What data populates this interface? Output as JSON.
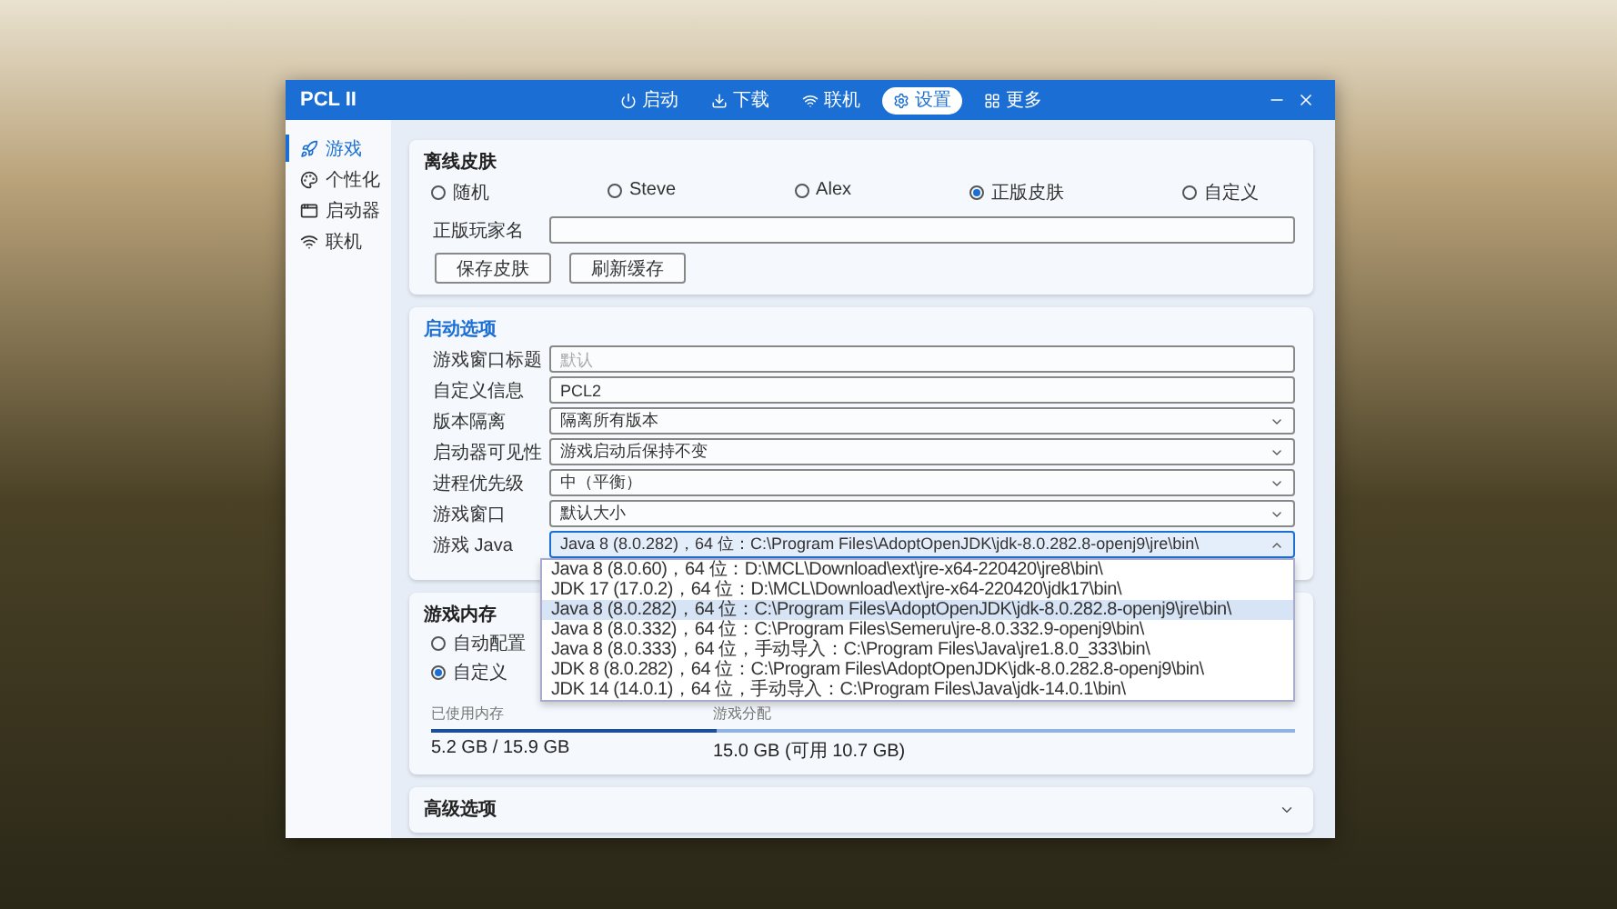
{
  "window": {
    "title": "PCL II"
  },
  "nav": [
    {
      "label": "启动",
      "selected": false
    },
    {
      "label": "下载",
      "selected": false
    },
    {
      "label": "联机",
      "selected": false
    },
    {
      "label": "设置",
      "selected": true
    },
    {
      "label": "更多",
      "selected": false
    }
  ],
  "sidebar": {
    "items": [
      {
        "label": "游戏",
        "selected": true
      },
      {
        "label": "个性化",
        "selected": false
      },
      {
        "label": "启动器",
        "selected": false
      },
      {
        "label": "联机",
        "selected": false
      }
    ]
  },
  "skin": {
    "title": "离线皮肤",
    "options": [
      {
        "label": "随机",
        "selected": false
      },
      {
        "label": "Steve",
        "selected": false
      },
      {
        "label": "Alex",
        "selected": false
      },
      {
        "label": "正版皮肤",
        "selected": true
      },
      {
        "label": "自定义",
        "selected": false
      }
    ],
    "name_label": "正版玩家名",
    "buttons": [
      "保存皮肤",
      "刷新缓存"
    ]
  },
  "launch": {
    "title": "启动选项",
    "rows": [
      {
        "kind": "text",
        "label": "游戏窗口标题",
        "placeholder": "默认"
      },
      {
        "kind": "text",
        "label": "自定义信息",
        "value": "PCL2"
      },
      {
        "kind": "select",
        "label": "版本隔离",
        "value": "隔离所有版本"
      },
      {
        "kind": "select",
        "label": "启动器可见性",
        "value": "游戏启动后保持不变"
      },
      {
        "kind": "select",
        "label": "进程优先级",
        "value": "中（平衡）"
      },
      {
        "kind": "select",
        "label": "游戏窗口",
        "value": "默认大小"
      },
      {
        "kind": "dropdown",
        "label": "游戏 Java",
        "value": "Java 8 (8.0.282)，64 位：C:\\Program Files\\AdoptOpenJDK\\jdk-8.0.282.8-openj9\\jre\\bin\\",
        "expanded": true,
        "options": [
          {
            "label": "Java 8 (8.0.60)，64 位：D:\\MCL\\Download\\ext\\jre-x64-220420\\jre8\\bin\\",
            "selected": false
          },
          {
            "label": "JDK 17 (17.0.2)，64 位：D:\\MCL\\Download\\ext\\jre-x64-220420\\jdk17\\bin\\",
            "selected": false
          },
          {
            "label": "Java 8 (8.0.282)，64 位：C:\\Program Files\\AdoptOpenJDK\\jdk-8.0.282.8-openj9\\jre\\bin\\",
            "selected": true
          },
          {
            "label": "Java 8 (8.0.332)，64 位：C:\\Program Files\\Semeru\\jre-8.0.332.9-openj9\\bin\\",
            "selected": false
          },
          {
            "label": "Java 8 (8.0.333)，64 位，手动导入：C:\\Program Files\\Java\\jre1.8.0_333\\bin\\",
            "selected": false
          },
          {
            "label": "JDK 8 (8.0.282)，64 位：C:\\Program Files\\AdoptOpenJDK\\jdk-8.0.282.8-openj9\\bin\\",
            "selected": false
          },
          {
            "label": "JDK 14 (14.0.1)，64 位，手动导入：C:\\Program Files\\Java\\jdk-14.0.1\\bin\\",
            "selected": false
          }
        ]
      }
    ]
  },
  "memory": {
    "title": "游戏内存",
    "options": [
      {
        "label": "自动配置",
        "selected": false
      },
      {
        "label": "自定义",
        "selected": true
      }
    ],
    "used_label": "已使用内存",
    "used_value": "5.2 GB / 15.9 GB",
    "level": 0.33,
    "alloc_label": "游戏分配",
    "alloc_value": "15.0 GB (可用 10.7 GB)"
  },
  "advanced": {
    "title": "高级选项",
    "expanded": false
  }
}
